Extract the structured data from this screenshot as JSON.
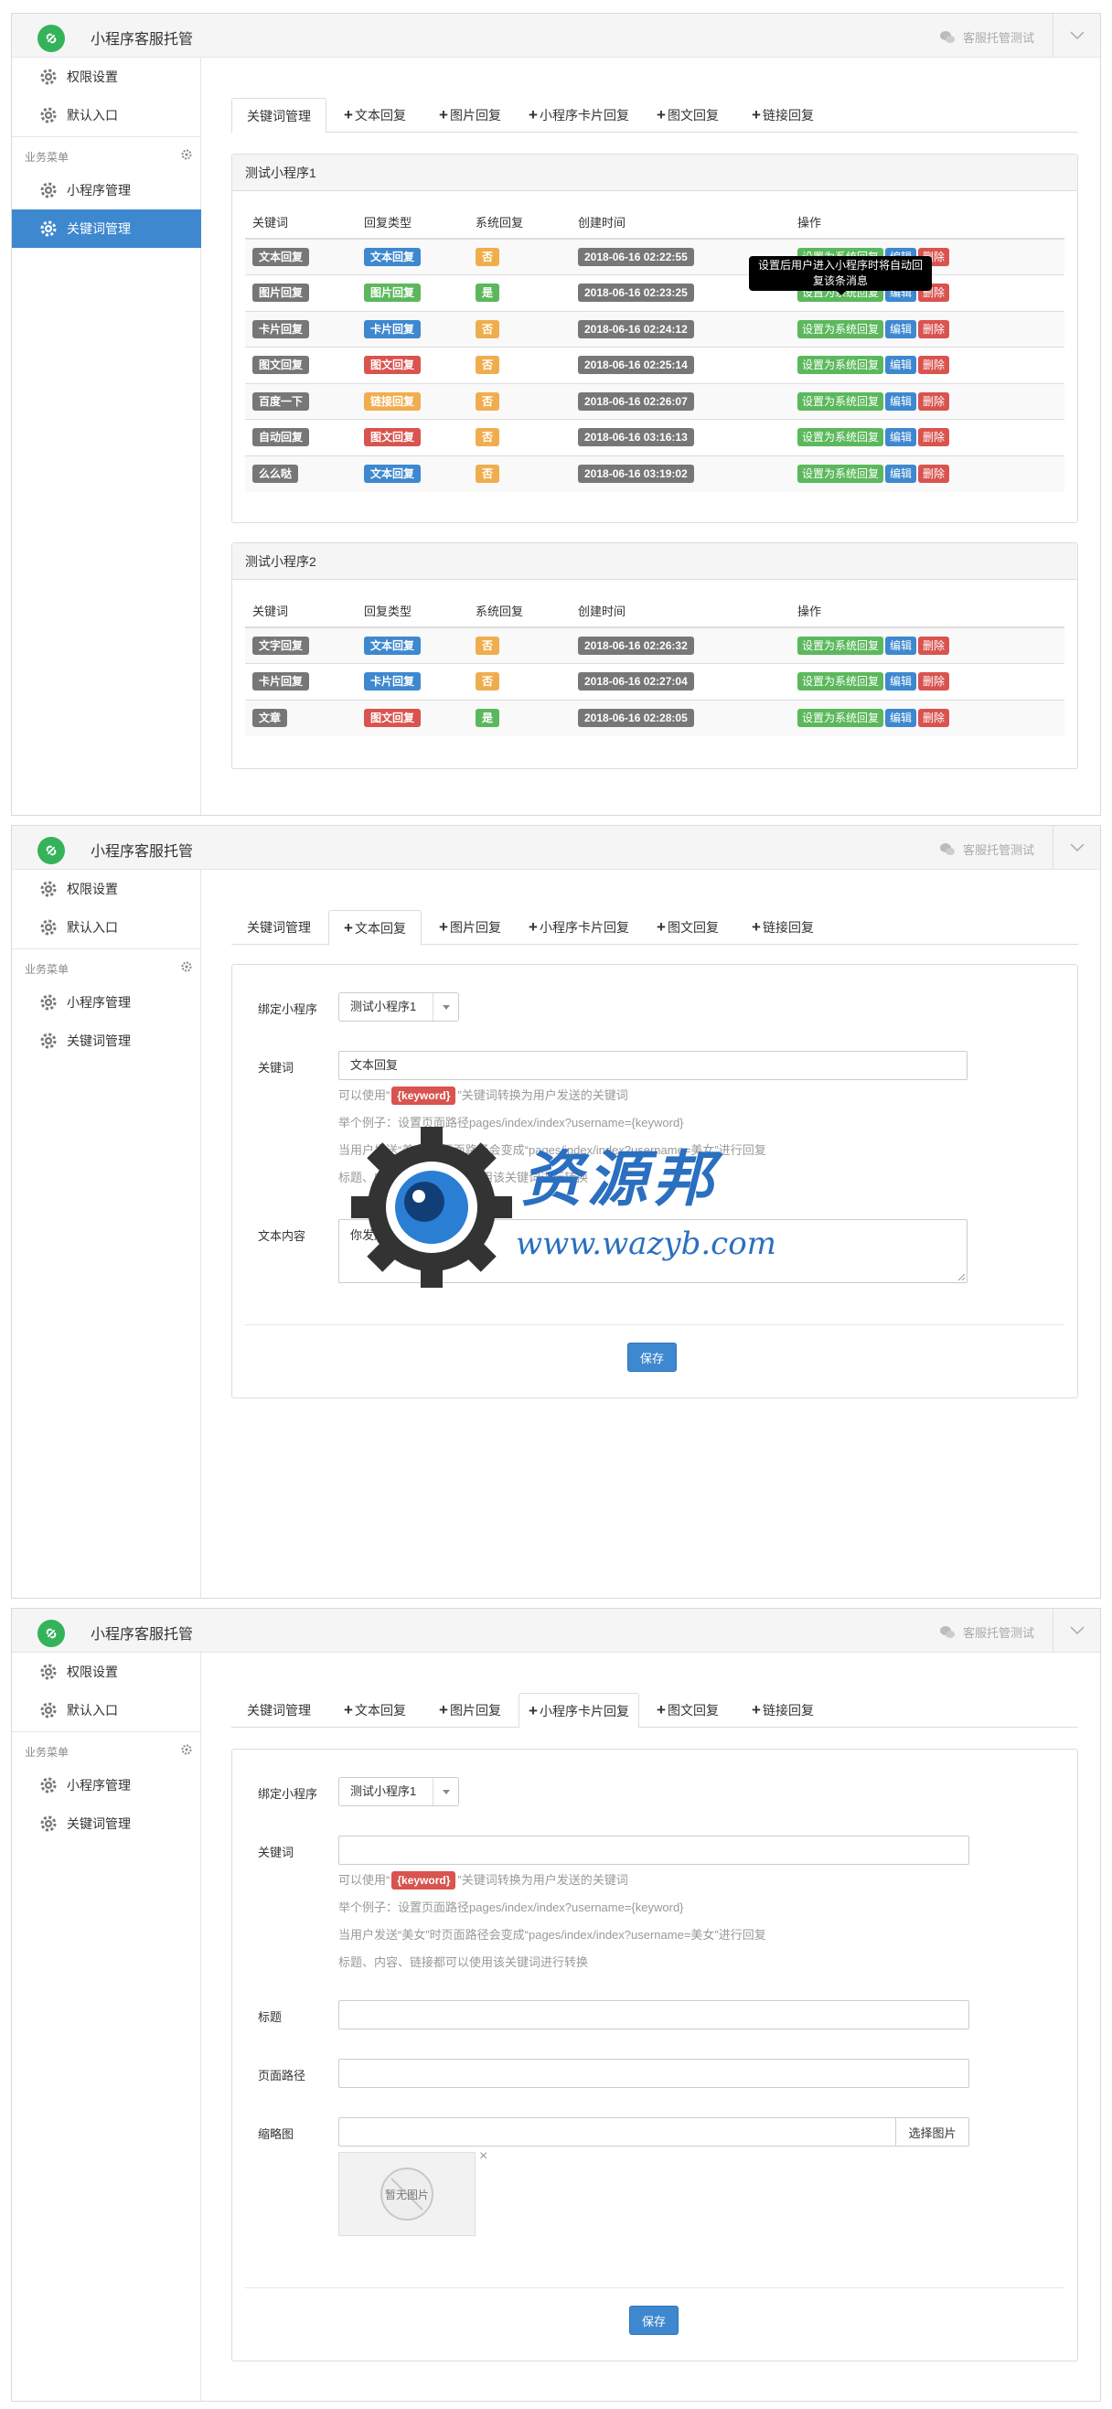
{
  "app": {
    "title": "小程序客服托管",
    "status": "客服托管测试"
  },
  "sidebar": {
    "items": [
      {
        "label": "权限设置",
        "icon": "gear-icon"
      },
      {
        "label": "默认入口",
        "icon": "gear-icon"
      }
    ],
    "section": "业务菜单",
    "business_items": [
      {
        "label": "小程序管理",
        "icon": "gear-icon"
      },
      {
        "label": "关键词管理",
        "icon": "gear-icon"
      }
    ]
  },
  "tabs": [
    {
      "label": "关键词管理",
      "plus": false
    },
    {
      "label": "文本回复",
      "plus": true
    },
    {
      "label": "图片回复",
      "plus": true
    },
    {
      "label": "小程序卡片回复",
      "plus": true
    },
    {
      "label": "图文回复",
      "plus": true
    },
    {
      "label": "链接回复",
      "plus": true
    }
  ],
  "plus_glyph": "+",
  "columns": [
    "关键词",
    "回复类型",
    "系统回复",
    "创建时间",
    "操作"
  ],
  "actions": {
    "set_system": "设置为系统回复",
    "edit": "编辑",
    "delete": "删除"
  },
  "tooltip": "设置后用户进入小程序时将自动回复该条消息",
  "panels": [
    {
      "title": "测试小程序1",
      "rows": [
        {
          "keyword": "文本回复",
          "type": "文本回复",
          "type_color": "#3e88cf",
          "system": "否",
          "time": "2018-06-16 02:22:55"
        },
        {
          "keyword": "图片回复",
          "type": "图片回复",
          "type_color": "#5cb85c",
          "system": "是",
          "time": "2018-06-16 02:23:25"
        },
        {
          "keyword": "卡片回复",
          "type": "卡片回复",
          "type_color": "#3e88cf",
          "system": "否",
          "time": "2018-06-16 02:24:12"
        },
        {
          "keyword": "图文回复",
          "type": "图文回复",
          "type_color": "#d9534f",
          "system": "否",
          "time": "2018-06-16 02:25:14"
        },
        {
          "keyword": "百度一下",
          "type": "链接回复",
          "type_color": "#f0ad4e",
          "system": "否",
          "time": "2018-06-16 02:26:07"
        },
        {
          "keyword": "自动回复",
          "type": "图文回复",
          "type_color": "#d9534f",
          "system": "否",
          "time": "2018-06-16 03:16:13"
        },
        {
          "keyword": "么么哒",
          "type": "文本回复",
          "type_color": "#3e88cf",
          "system": "否",
          "time": "2018-06-16 03:19:02"
        }
      ]
    },
    {
      "title": "测试小程序2",
      "rows": [
        {
          "keyword": "文字回复",
          "type": "文本回复",
          "type_color": "#3e88cf",
          "system": "否",
          "time": "2018-06-16 02:26:32"
        },
        {
          "keyword": "卡片回复",
          "type": "卡片回复",
          "type_color": "#3e88cf",
          "system": "否",
          "time": "2018-06-16 02:27:04"
        },
        {
          "keyword": "文章",
          "type": "图文回复",
          "type_color": "#d9534f",
          "system": "是",
          "time": "2018-06-16 02:28:05"
        }
      ]
    }
  ],
  "form_text": {
    "bind_label": "绑定小程序",
    "bind_value": "测试小程序1",
    "keyword_label": "关键词",
    "keyword_value": "文本回复",
    "help1_pre": "可以使用“",
    "help1_tag": "{keyword}",
    "help1_post": "”关键词转换为用户发送的关键词",
    "help2": "举个例子：设置页面路径pages/index/index?username={keyword}",
    "help3": "当用户发送“美女”时页面路径会变成“pages/index/index?username=美女”进行回复",
    "help4": "标题、内容、链接都可以使用该关键词进行转换",
    "content_label": "文本内容",
    "content_value": "你发送了：{keyword}",
    "save": "保存"
  },
  "form_card": {
    "bind_label": "绑定小程序",
    "bind_value": "测试小程序1",
    "keyword_label": "关键词",
    "keyword_value": "",
    "help1_pre": "可以使用“",
    "help1_tag": "{keyword}",
    "help1_post": "”关键词转换为用户发送的关键词",
    "help2": "举个例子：设置页面路径pages/index/index?username={keyword}",
    "help3": "当用户发送“美女”时页面路径会变成“pages/index/index?username=美女”进行回复",
    "help4": "标题、内容、链接都可以使用该关键词进行转换",
    "title_label": "标题",
    "path_label": "页面路径",
    "thumb_label": "缩略图",
    "choose": "选择图片",
    "no_image": "暂无图片",
    "close": "×",
    "save": "保存"
  },
  "watermark": {
    "cn": "资源邦",
    "url": "www.wazyb.com"
  }
}
